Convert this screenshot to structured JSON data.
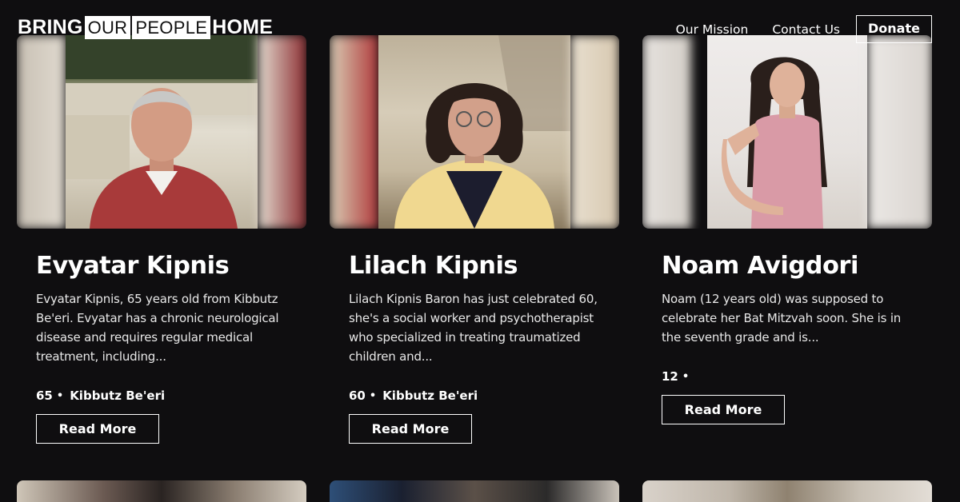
{
  "header": {
    "logo": {
      "word1": "BRING",
      "word2": "OUR",
      "word3": "PEOPLE",
      "word4": "HOME"
    },
    "nav": [
      {
        "label": "Our Mission"
      },
      {
        "label": "Contact Us"
      }
    ],
    "donate_label": "Donate"
  },
  "cards": [
    {
      "name": "Evyatar Kipnis",
      "description": "Evyatar Kipnis, 65 years old from Kibbutz Be'eri. Evyatar has a chronic neurological disease and requires regular medical treatment, including...",
      "age": "65",
      "location": "Kibbutz Be'eri",
      "read_more": "Read More"
    },
    {
      "name": "Lilach Kipnis",
      "description": "Lilach Kipnis Baron has just celebrated 60, she's a social worker and psychotherapist who specialized in treating traumatized children and...",
      "age": "60",
      "location": "Kibbutz Be'eri",
      "read_more": "Read More"
    },
    {
      "name": "Noam Avigdori",
      "description": "Noam (12 years old) was supposed to celebrate her Bat Mitzvah soon. She is in the seventh grade and is...",
      "age": "12",
      "location": "",
      "read_more": "Read More"
    }
  ],
  "meta_separator": "•",
  "colors": {
    "background": "#0f0e10",
    "text": "#ffffff",
    "button_border": "#ffffff"
  }
}
